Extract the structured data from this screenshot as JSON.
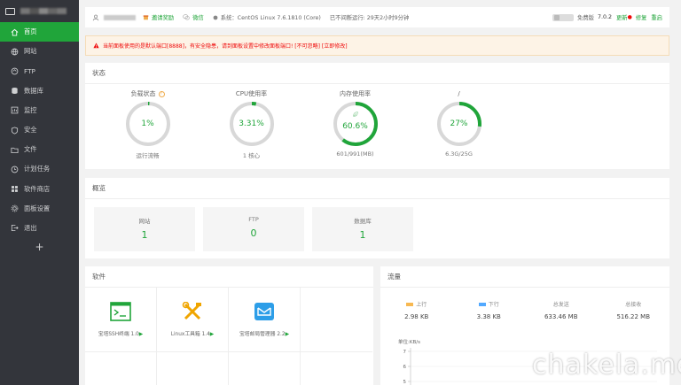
{
  "nav": {
    "items": [
      {
        "label": "首页",
        "icon": "home-icon"
      },
      {
        "label": "网站",
        "icon": "globe-icon"
      },
      {
        "label": "FTP",
        "icon": "ftp-icon"
      },
      {
        "label": "数据库",
        "icon": "database-icon"
      },
      {
        "label": "监控",
        "icon": "monitor-icon"
      },
      {
        "label": "安全",
        "icon": "shield-icon"
      },
      {
        "label": "文件",
        "icon": "folder-icon"
      },
      {
        "label": "计划任务",
        "icon": "clock-icon"
      },
      {
        "label": "软件商店",
        "icon": "store-icon"
      },
      {
        "label": "面板设置",
        "icon": "settings-icon"
      },
      {
        "label": "退出",
        "icon": "logout-icon"
      }
    ],
    "add_label": "+"
  },
  "header": {
    "reward": "邀请奖励",
    "wechat": "微信",
    "system": "系统：CentOS Linux 7.6.1810 (Core)",
    "uptime": "已不间断运行: 29天2小时9分钟",
    "edition": "免费版",
    "version": "7.0.2",
    "update": "更新",
    "repair": "修复",
    "restart": "重启"
  },
  "alert": {
    "text": "当前面板使用的是默认端口[8888]，有安全隐患，请到面板设置中修改面板端口! [不可忽略] [立即修改]"
  },
  "status": {
    "title": "状态",
    "gauges": [
      {
        "label": "负载状态",
        "value": "1%",
        "sub": "运行流畅",
        "percent": 1,
        "help": "?"
      },
      {
        "label": "CPU使用率",
        "value": "3.31%",
        "sub": "1 核心",
        "percent": 3.31
      },
      {
        "label": "内存使用率",
        "value": "60.6%",
        "sub": "601/991(MB)",
        "percent": 60.6
      },
      {
        "label": "/",
        "value": "27%",
        "sub": "6.3G/25G",
        "percent": 27
      }
    ]
  },
  "overview": {
    "title": "概览",
    "boxes": [
      {
        "label": "网站",
        "value": "1"
      },
      {
        "label": "FTP",
        "value": "0"
      },
      {
        "label": "数据库",
        "value": "1"
      }
    ]
  },
  "software": {
    "title": "软件",
    "items": [
      {
        "name": "宝塔SSH终端 1.0",
        "icon": "terminal-icon"
      },
      {
        "name": "Linux工具箱 1.4",
        "icon": "tools-icon"
      },
      {
        "name": "宝塔邮局管理器 2.2",
        "icon": "mail-icon"
      }
    ]
  },
  "traffic": {
    "title": "流量",
    "stats": [
      {
        "label": "上行",
        "value": "2.98 KB",
        "color": "#f7b851"
      },
      {
        "label": "下行",
        "value": "3.38 KB",
        "color": "#52a9ff"
      },
      {
        "label": "总发送",
        "value": "633.46 MB"
      },
      {
        "label": "总接收",
        "value": "516.22 MB"
      }
    ],
    "unit": "单位:KB/s",
    "y_ticks": [
      "7",
      "6",
      "5"
    ]
  },
  "watermark": "chakela.me",
  "colors": {
    "accent": "#20a53a",
    "sidebar": "#33353b",
    "alert": "#ef0808"
  }
}
